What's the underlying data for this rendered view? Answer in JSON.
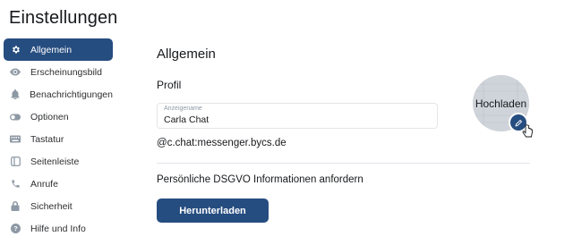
{
  "page": {
    "title": "Einstellungen"
  },
  "sidebar": {
    "items": [
      {
        "label": "Allgemein",
        "icon": "gear-icon",
        "active": true
      },
      {
        "label": "Erscheinungsbild",
        "icon": "eye-icon",
        "active": false
      },
      {
        "label": "Benachrichtigungen",
        "icon": "bell-icon",
        "active": false
      },
      {
        "label": "Optionen",
        "icon": "toggle-icon",
        "active": false
      },
      {
        "label": "Tastatur",
        "icon": "keyboard-icon",
        "active": false
      },
      {
        "label": "Seitenleiste",
        "icon": "sidebar-icon",
        "active": false
      },
      {
        "label": "Anrufe",
        "icon": "phone-icon",
        "active": false
      },
      {
        "label": "Sicherheit",
        "icon": "lock-icon",
        "active": false
      },
      {
        "label": "Hilfe und Info",
        "icon": "help-icon",
        "active": false
      }
    ]
  },
  "main": {
    "section_title": "Allgemein",
    "profile_title": "Profil",
    "display_name": {
      "label": "Anzeigename",
      "value": "Carla Chat"
    },
    "mxid": "@c.chat:messenger.bycs.de",
    "dsgvo_text": "Persönliche DSGVO Informationen anfordern",
    "download_label": "Herunterladen",
    "avatar_upload_label": "Hochladen"
  },
  "colors": {
    "accent": "#264d80",
    "text": "#17191c",
    "border": "#e3e5e8"
  }
}
